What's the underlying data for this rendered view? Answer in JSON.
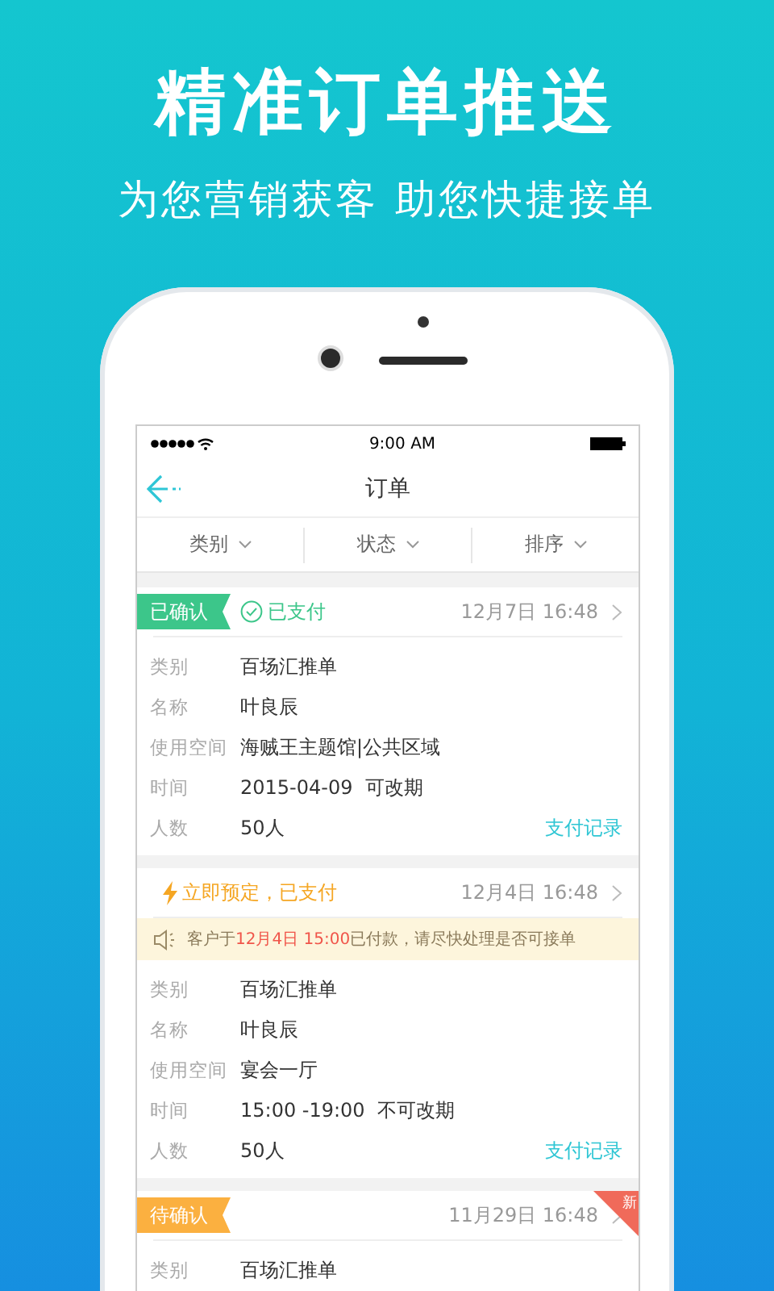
{
  "headline": "精准订单推送",
  "subtitle": "为您营销获客 助您快捷接单",
  "status_bar": {
    "time": "9:00 AM"
  },
  "nav": {
    "title": "订单"
  },
  "filters": [
    {
      "label": "类别"
    },
    {
      "label": "状态"
    },
    {
      "label": "排序"
    }
  ],
  "orders": [
    {
      "kind": "confirmed",
      "badge": "已确认",
      "paid": "已支付",
      "time": "12月7日 16:48",
      "rows": [
        {
          "label": "类别",
          "value": "百场汇推单"
        },
        {
          "label": "名称",
          "value": "叶良辰"
        },
        {
          "label": "使用空间",
          "value": "海贼王主题馆|公共区域"
        },
        {
          "label": "时间",
          "value": "2015-04-09  可改期"
        },
        {
          "label": "人数",
          "value": "50人"
        }
      ],
      "link": "支付记录"
    },
    {
      "kind": "instant",
      "paid": "立即预定，已支付",
      "time": "12月4日 16:48",
      "notice": {
        "before": "客户于",
        "highlight": "12月4日 15:00",
        "after": "已付款，请尽快处理是否可接单"
      },
      "rows": [
        {
          "label": "类别",
          "value": "百场汇推单"
        },
        {
          "label": "名称",
          "value": "叶良辰"
        },
        {
          "label": "使用空间",
          "value": "宴会一厅"
        },
        {
          "label": "时间",
          "value": "15:00 -19:00  不可改期"
        },
        {
          "label": "人数",
          "value": "50人"
        }
      ],
      "link": "支付记录"
    },
    {
      "kind": "pending",
      "badge": "待确认",
      "time": "11月29日 16:48",
      "new_tag": "新",
      "rows": [
        {
          "label": "类别",
          "value": "百场汇推单"
        }
      ]
    }
  ]
}
